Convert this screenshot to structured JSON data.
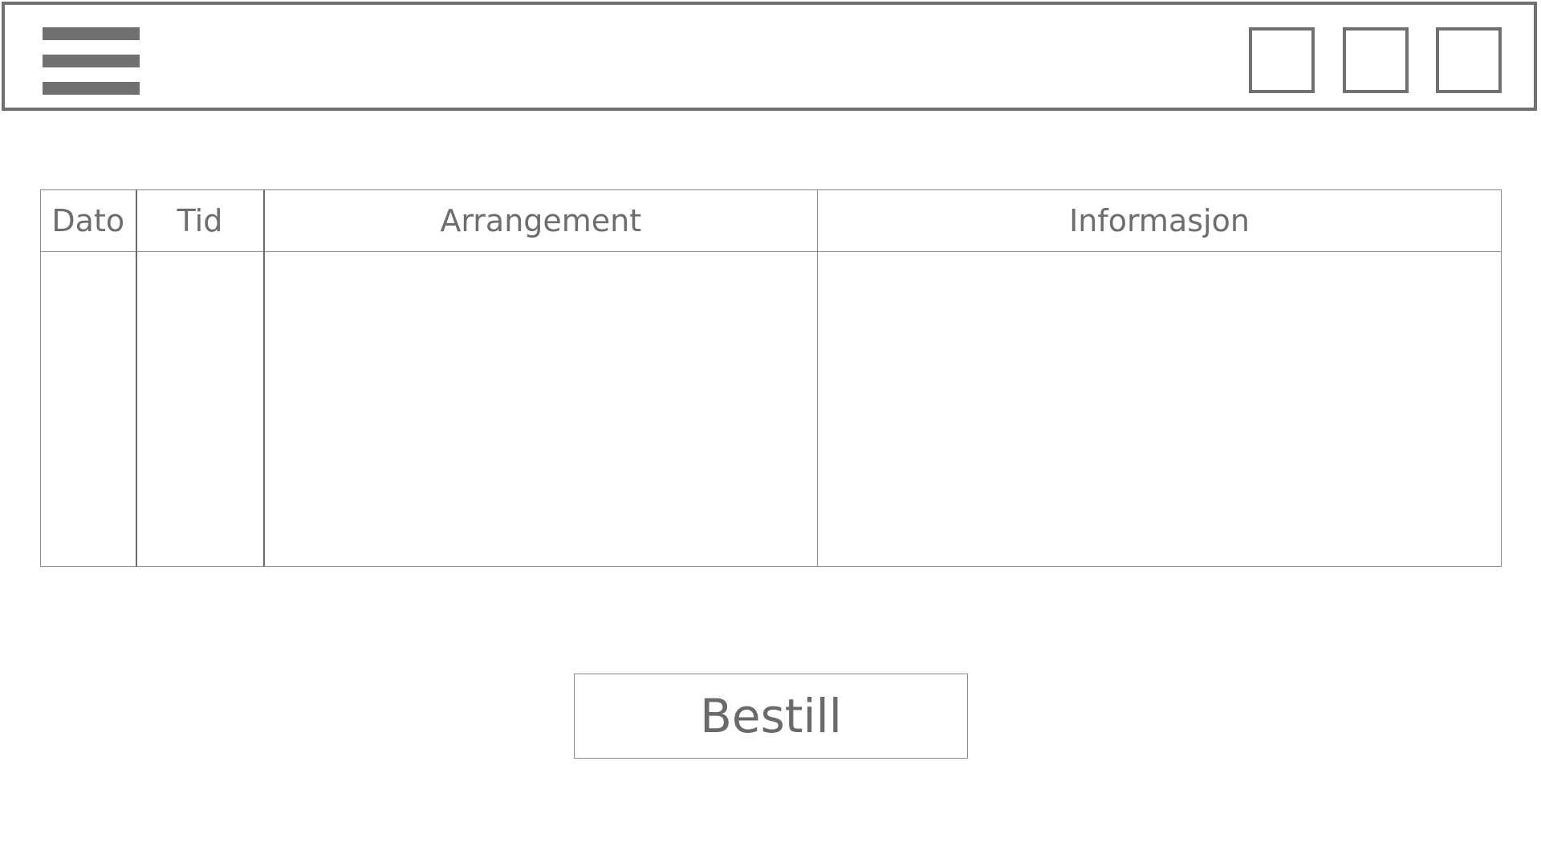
{
  "header": {
    "menu_icon": "hamburger-menu-icon",
    "right_controls": [
      "square-box-1",
      "square-box-2",
      "square-box-3"
    ]
  },
  "table": {
    "columns": [
      "Dato",
      "Tid",
      "Arrangement",
      "Informasjon"
    ],
    "rows": [
      [
        "",
        "",
        "",
        ""
      ]
    ]
  },
  "actions": {
    "order_label": "Bestill"
  },
  "colors": {
    "wireframe_stroke": "#707070",
    "text": "#6e6e6e",
    "background": "#ffffff"
  }
}
